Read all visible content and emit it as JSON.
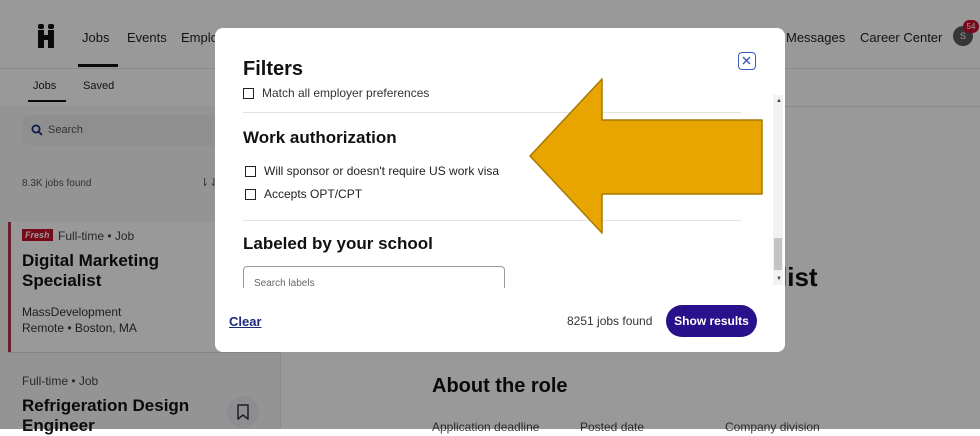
{
  "topbar": {
    "nav": [
      "Jobs",
      "Events",
      "Emplo"
    ],
    "right_links": [
      "Messages",
      "Career Center"
    ],
    "avatar_initial": "S",
    "notification_count": "54"
  },
  "subtabs": [
    "Jobs",
    "Saved"
  ],
  "search": {
    "placeholder": "Search"
  },
  "left": {
    "jobs_found": "8.3K jobs found",
    "cards": [
      {
        "tag": "Fresh",
        "meta": "Full-time • Job",
        "title_lines": [
          "Digital Marketing",
          "Specialist"
        ],
        "company": "MassDevelopment",
        "location": "Remote • Boston, MA"
      },
      {
        "meta": "Full-time • Job",
        "title_lines": [
          "Refrigeration Design",
          "Engineer"
        ]
      }
    ]
  },
  "detail": {
    "title_fragment": "list",
    "about_heading": "About the role",
    "labels": [
      "Application deadline",
      "Posted date",
      "Company division"
    ]
  },
  "modal": {
    "title": "Filters",
    "cut_option": "Match all employer preferences",
    "work_auth": {
      "heading": "Work authorization",
      "options": [
        "Will sponsor or doesn't require US work visa",
        "Accepts OPT/CPT"
      ]
    },
    "labeled": {
      "heading": "Labeled by your school",
      "search_placeholder": "Search labels"
    },
    "footer": {
      "clear": "Clear",
      "found": "8251 jobs found",
      "show_results": "Show results"
    }
  },
  "colors": {
    "accent": "#28118a",
    "arrow": "#e8a500",
    "fresh_tag": "#c8102e"
  }
}
